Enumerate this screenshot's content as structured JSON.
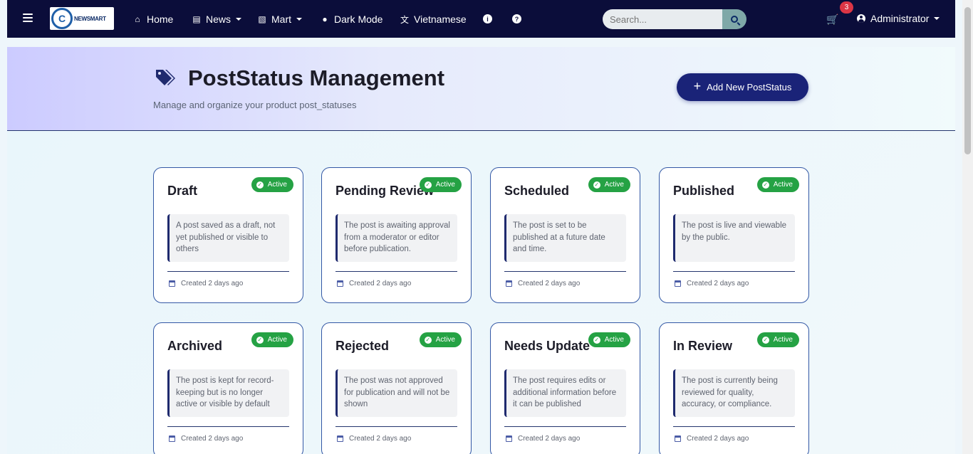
{
  "navbar": {
    "brand": "NEWSMART",
    "items": [
      {
        "label": "Home",
        "icon": "home-icon"
      },
      {
        "label": "News",
        "icon": "newspaper-icon"
      },
      {
        "label": "Mart",
        "icon": "store-icon"
      },
      {
        "label": "Dark Mode",
        "icon": "palette-icon"
      },
      {
        "label": "Vietnamese",
        "icon": "language-icon"
      }
    ],
    "info_icon": "i",
    "help_icon": "?",
    "search_placeholder": "Search...",
    "cart_count": "3",
    "user_label": "Administrator"
  },
  "header": {
    "title": "PostStatus Management",
    "subtitle": "Manage and organize your product post_statuses",
    "add_button": "Add New PostStatus"
  },
  "cards": [
    {
      "title": "Draft",
      "badge": "Active",
      "desc": "A post saved as a draft, not yet published or visible to others",
      "created": "Created 2 days ago"
    },
    {
      "title": "Pending Review",
      "badge": "Active",
      "desc": "The post is awaiting approval from a moderator or editor before publication.",
      "created": "Created 2 days ago"
    },
    {
      "title": "Scheduled",
      "badge": "Active",
      "desc": "The post is set to be published at a future date and time.",
      "created": "Created 2 days ago"
    },
    {
      "title": "Published",
      "badge": "Active",
      "desc": "The post is live and viewable by the public.",
      "created": "Created 2 days ago"
    },
    {
      "title": "Archived",
      "badge": "Active",
      "desc": "The post is kept for record-keeping but is no longer active or visible by default",
      "created": "Created 2 days ago"
    },
    {
      "title": "Rejected",
      "badge": "Active",
      "desc": "The post was not approved for publication and will not be shown",
      "created": "Created 2 days ago"
    },
    {
      "title": "Needs Update",
      "badge": "Active",
      "desc": "The post requires edits or additional information before it can be published",
      "created": "Created 2 days ago"
    },
    {
      "title": "In Review",
      "badge": "Active",
      "desc": "The post is currently being reviewed for quality, accuracy, or compliance.",
      "created": "Created 2 days ago"
    }
  ],
  "colors": {
    "navbar": "#0b0d3a",
    "accent": "#1a2378",
    "active_badge": "#25a244",
    "cart_badge": "#dc3545"
  }
}
